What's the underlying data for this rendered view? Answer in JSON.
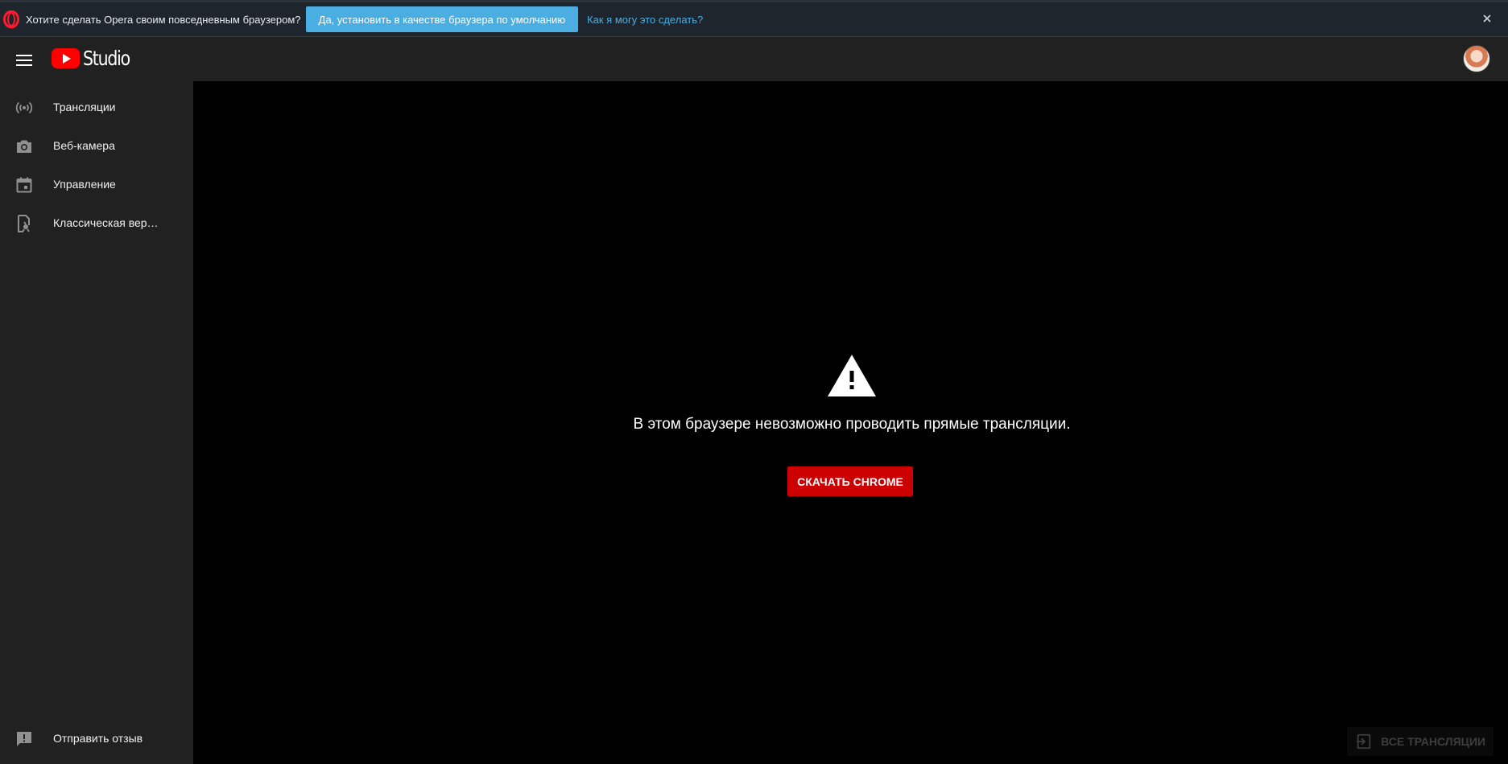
{
  "infobar": {
    "question": "Хотите сделать Opera своим повседневным браузером?",
    "yes_button": "Да, установить в качестве браузера по умолчанию",
    "howto_link": "Как я могу это сделать?",
    "close_symbol": "×"
  },
  "header": {
    "logo_text": "Studio",
    "brand_color": "#ff0000"
  },
  "sidebar": {
    "items": [
      {
        "label": "Трансляции",
        "icon": "live-broadcast-icon"
      },
      {
        "label": "Веб-камера",
        "icon": "camera-icon"
      },
      {
        "label": "Управление",
        "icon": "calendar-icon"
      },
      {
        "label": "Классическая вер…",
        "icon": "classic-studio-icon"
      }
    ],
    "feedback": {
      "label": "Отправить отзыв",
      "icon": "feedback-icon"
    }
  },
  "main": {
    "warning_icon": "warning-icon",
    "message": "В этом браузере невозможно проводить прямые трансляции.",
    "download_button": "СКАЧАТЬ CHROME",
    "all_streams_button": "ВСЕ ТРАНСЛЯЦИИ",
    "all_streams_icon": "exit-to-app-icon"
  },
  "colors": {
    "accent_blue": "#4aaee3",
    "button_red": "#cc0000",
    "sidebar_bg": "#212121",
    "content_bg": "#000000"
  }
}
